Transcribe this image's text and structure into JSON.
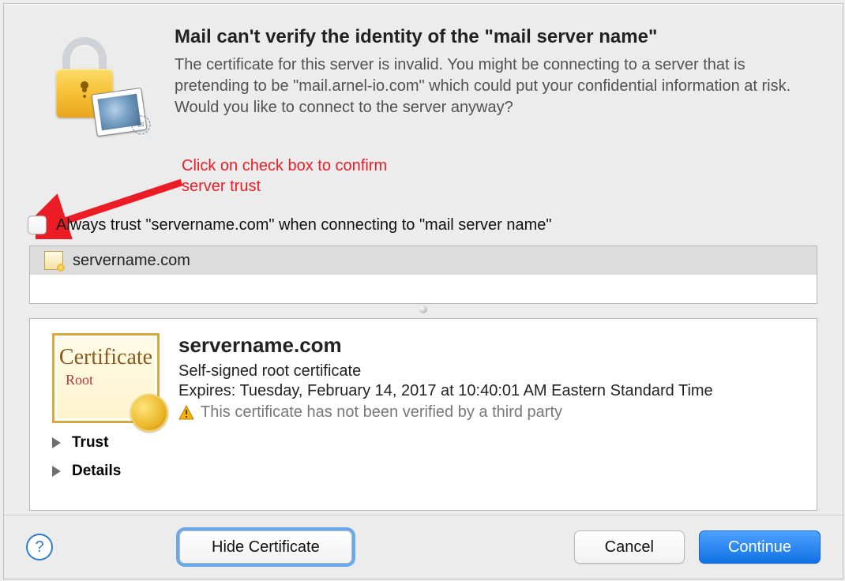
{
  "header": {
    "title": "Mail can't verify the identity of the \"mail server name\"",
    "description": "The certificate for this server is invalid. You might be connecting to a server that is pretending to be \"mail.arnel-io.com\" which could put your confidential information at risk. Would you like to connect to the server anyway?"
  },
  "annotation_line1": "Click on check box to confirm",
  "annotation_line2": "server trust",
  "trust_checkbox_label": "Always trust \"servername.com\" when connecting to \"mail server name\"",
  "cert_list_item": "servername.com",
  "details": {
    "name": "servername.com",
    "type": "Self-signed root certificate",
    "expires": "Expires: Tuesday, February 14, 2017 at 10:40:01 AM Eastern Standard Time",
    "warning": "This certificate has not been verified by a third party",
    "cert_word": "Certificate",
    "root_word": "Root",
    "disclose_trust": "Trust",
    "disclose_details": "Details"
  },
  "buttons": {
    "help": "?",
    "hide": "Hide Certificate",
    "cancel": "Cancel",
    "cont": "Continue"
  }
}
